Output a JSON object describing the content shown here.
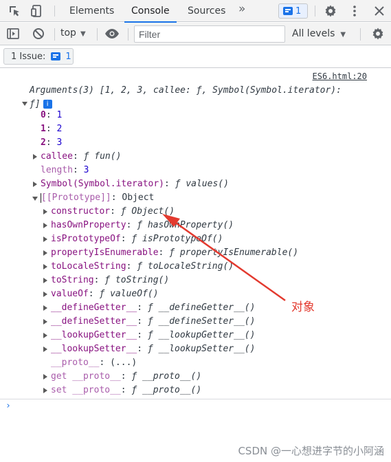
{
  "tabs": [
    {
      "label": "Elements"
    },
    {
      "label": "Console"
    },
    {
      "label": "Sources"
    }
  ],
  "more_tabs": "»",
  "issue_chip_count": "1",
  "toolbar": {
    "context": "top",
    "filter_placeholder": "Filter",
    "levels": "All levels"
  },
  "issues_bar": {
    "label": "1 Issue:",
    "count": "1"
  },
  "source_link": "ES6.html:20",
  "arguments_header": {
    "line1": "Arguments(3) [1, 2, 3, callee: ƒ, Symbol(Symbol.iterator):",
    "line2": "ƒ]"
  },
  "entries": {
    "i0": {
      "key": "0",
      "value": "1"
    },
    "i1": {
      "key": "1",
      "value": "2"
    },
    "i2": {
      "key": "2",
      "value": "3"
    },
    "callee": {
      "key": "callee",
      "value": "ƒ fun()"
    },
    "length": {
      "key": "length",
      "value": "3"
    },
    "symbol": {
      "key": "Symbol(Symbol.iterator)",
      "value": "ƒ values()"
    },
    "prototype": {
      "key": "[[Prototype]]",
      "value": "Object"
    }
  },
  "proto_methods": [
    {
      "key": "constructor",
      "value": "ƒ Object()"
    },
    {
      "key": "hasOwnProperty",
      "value": "ƒ hasOwnProperty()"
    },
    {
      "key": "isPrototypeOf",
      "value": "ƒ isPrototypeOf()"
    },
    {
      "key": "propertyIsEnumerable",
      "value": "ƒ propertyIsEnumerable()"
    },
    {
      "key": "toLocaleString",
      "value": "ƒ toLocaleString()"
    },
    {
      "key": "toString",
      "value": "ƒ toString()"
    },
    {
      "key": "valueOf",
      "value": "ƒ valueOf()"
    },
    {
      "key": "__defineGetter__",
      "value": "ƒ __defineGetter__()"
    },
    {
      "key": "__defineSetter__",
      "value": "ƒ __defineSetter__()"
    },
    {
      "key": "__lookupGetter__",
      "value": "ƒ __lookupGetter__()"
    },
    {
      "key": "__lookupSetter__",
      "value": "ƒ __lookupSetter__()"
    },
    {
      "key": "__proto__",
      "value": "(...)"
    },
    {
      "key": "get __proto__",
      "value": "ƒ __proto__()"
    },
    {
      "key": "set __proto__",
      "value": "ƒ __proto__()"
    }
  ],
  "prompt_symbol": "›",
  "annotation": {
    "text": "对象",
    "color": "#e33a2f"
  },
  "watermark": "CSDN @一心想进字节的小阿涵",
  "colors": {
    "accent": "#1a73e8",
    "key": "#881280",
    "number": "#1c00cf"
  }
}
